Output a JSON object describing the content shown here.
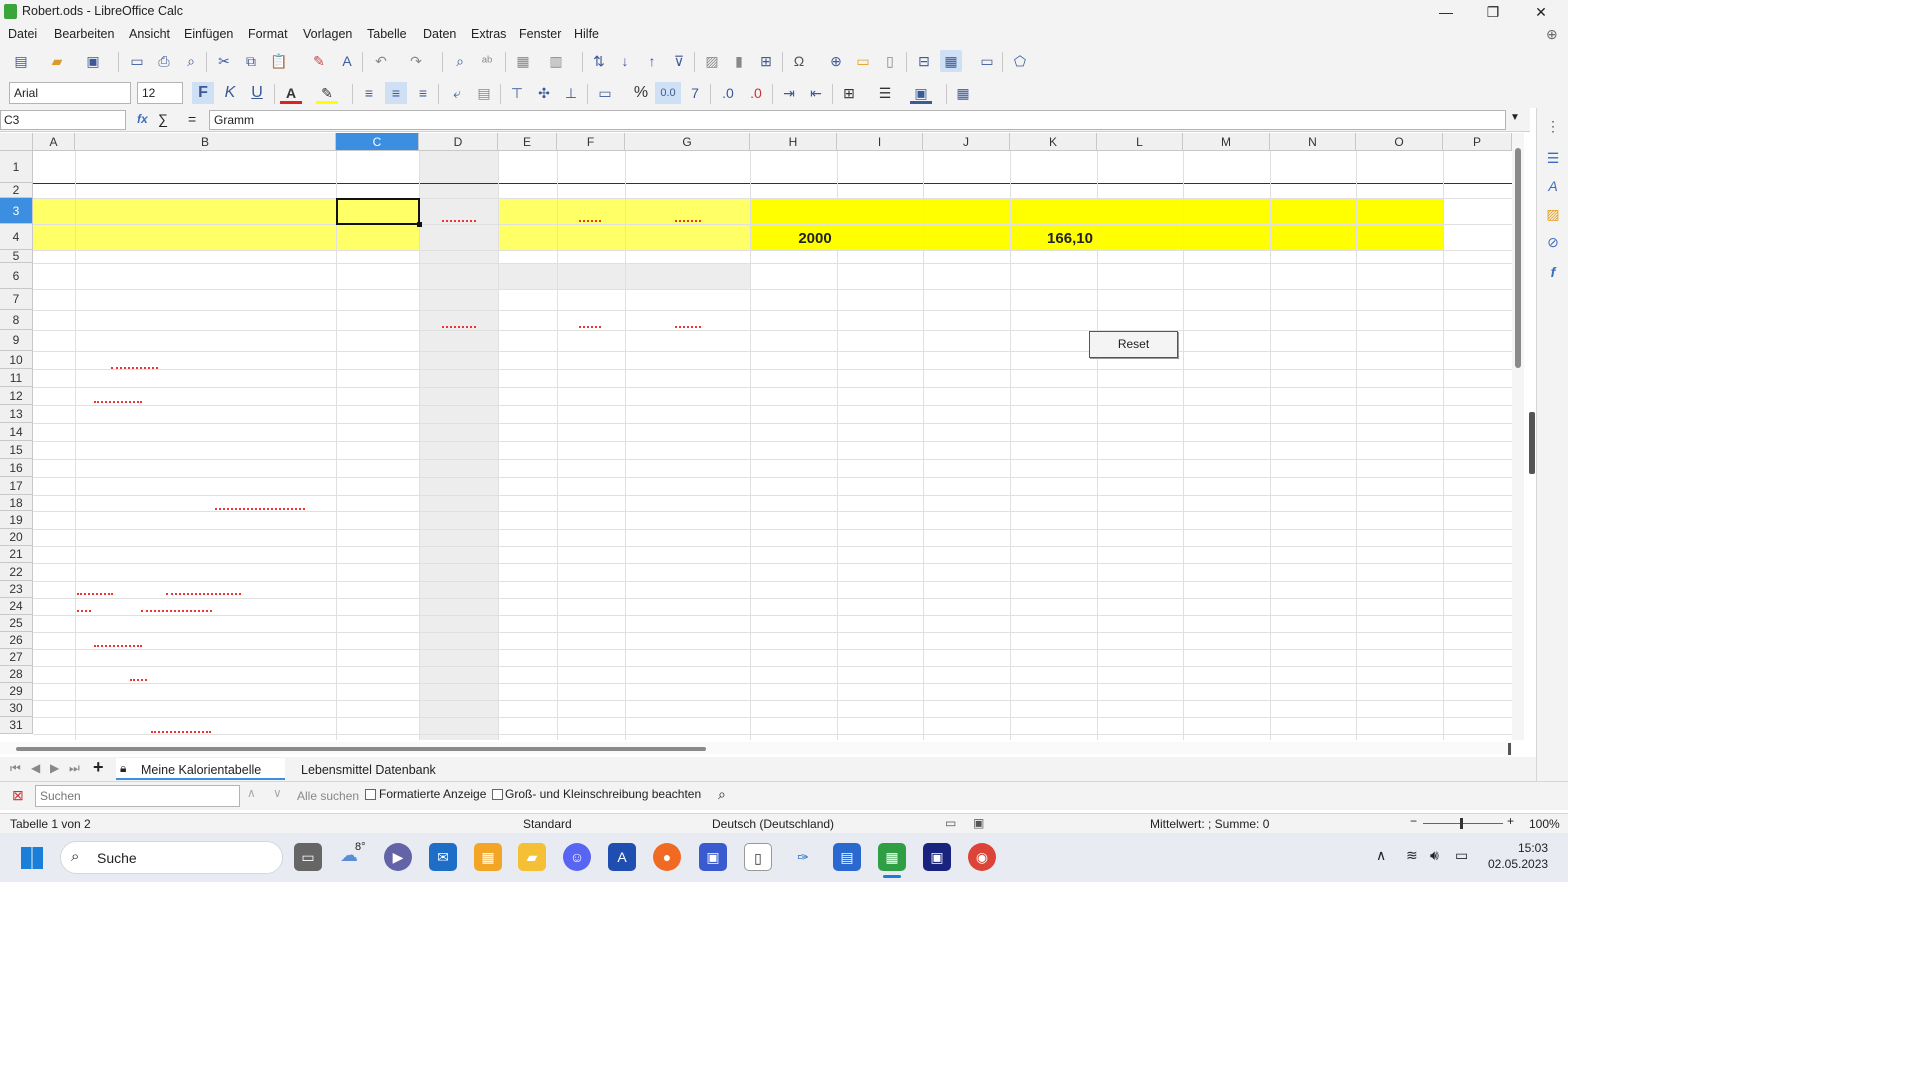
{
  "window": {
    "title": "Robert.ods - LibreOffice Calc",
    "controls": {
      "minimize": "—",
      "maximize": "❐",
      "close": "✕"
    }
  },
  "menu": [
    "Datei",
    "Bearbeiten",
    "Ansicht",
    "Einfügen",
    "Format",
    "Vorlagen",
    "Tabelle",
    "Daten",
    "Extras",
    "Fenster",
    "Hilfe"
  ],
  "formatting": {
    "font_name": "Arial",
    "font_size": "12",
    "bold": "F",
    "italic": "K",
    "underline": "U",
    "percent": "%",
    "number": "0.0"
  },
  "formula_bar": {
    "cell_ref": "C3",
    "fx": "fx",
    "sum": "∑",
    "equals": "=",
    "content": "Gramm"
  },
  "columns": [
    "A",
    "B",
    "C",
    "D",
    "E",
    "F",
    "G",
    "H",
    "I",
    "J",
    "K",
    "L",
    "M",
    "N",
    "O",
    "P"
  ],
  "selected_column": "C",
  "rows": [
    "1",
    "2",
    "3",
    "4",
    "5",
    "6",
    "7",
    "8",
    "9",
    "10",
    "11",
    "12",
    "13",
    "14",
    "15",
    "16",
    "17",
    "18",
    "19",
    "20",
    "21",
    "22",
    "23",
    "24",
    "25",
    "26",
    "27",
    "28",
    "29",
    "30",
    "31"
  ],
  "selected_row": "3",
  "cells": {
    "H4": "2000",
    "K4": "166,10"
  },
  "reset_button": "Reset",
  "sheet_tabs": {
    "active": "Meine Kalorientabelle",
    "other": "Lebensmittel Datenbank"
  },
  "find_bar": {
    "placeholder": "Suchen",
    "find_all": "Alle suchen",
    "formatted_display": "Formatierte Anzeige",
    "match_case": "Groß- und Kleinschreibung beachten"
  },
  "status_bar": {
    "sheet_info": "Tabelle 1 von 2",
    "page_style": "Standard",
    "language": "Deutsch (Deutschland)",
    "summary": "Mittelwert: ; Summe: 0",
    "zoom": "100%"
  },
  "taskbar": {
    "search": "Suche",
    "weather": "8°",
    "time": "15:03",
    "date": "02.05.2023"
  },
  "colors": {
    "highlight_yellow": "#ffff00",
    "light_yellow": "#ffff66",
    "selection_blue": "#3c8ee0",
    "gray_column": "#ededed"
  }
}
